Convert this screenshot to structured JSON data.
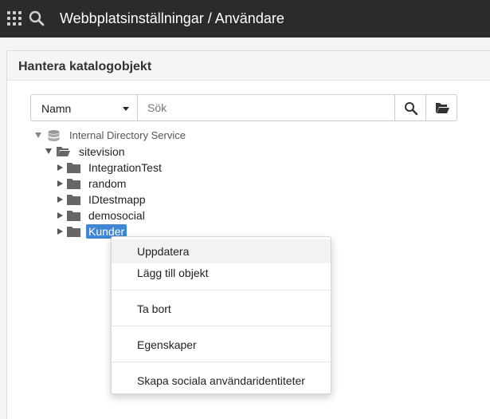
{
  "topbar": {
    "title": "Webbplatsinställningar / Användare",
    "icons": [
      "apps-grid-icon",
      "search-icon"
    ]
  },
  "panel": {
    "title": "Hantera katalogobjekt"
  },
  "toolbar": {
    "select_value": "Namn",
    "search_placeholder": "Sök",
    "search_value": "",
    "buttons": [
      "search-icon",
      "folder-open-icon"
    ]
  },
  "tree": {
    "root": "Internal Directory Service",
    "child": "sitevision",
    "folders": [
      "IntegrationTest",
      "random",
      "IDtestmapp",
      "demosocial",
      "Kunder"
    ],
    "selected": "Kunder"
  },
  "context_menu": {
    "items": [
      "Uppdatera",
      "Lägg till objekt",
      "Ta bort",
      "Egenskaper",
      "Skapa sociala användaridentiteter"
    ],
    "highlighted": "Uppdatera"
  },
  "colors": {
    "topbar": "#2b2b2b",
    "selection": "#3f86d6"
  }
}
